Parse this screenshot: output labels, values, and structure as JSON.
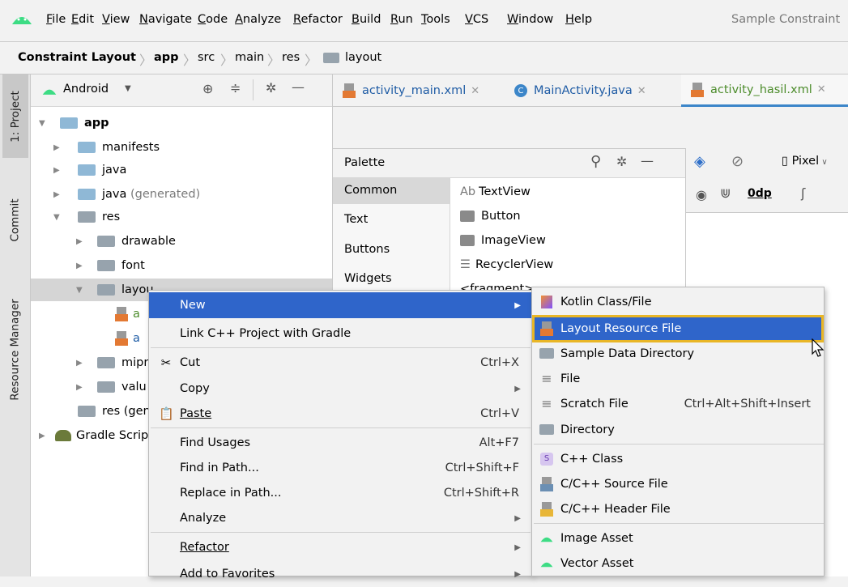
{
  "menubar": {
    "items": [
      "File",
      "Edit",
      "View",
      "Navigate",
      "Code",
      "Analyze",
      "Refactor",
      "Build",
      "Run",
      "Tools",
      "VCS",
      "Window",
      "Help"
    ],
    "window_title": "Sample Constraint"
  },
  "breadcrumb": [
    "Constraint Layout",
    "app",
    "src",
    "main",
    "res",
    "layout"
  ],
  "tool_stripe": {
    "project_tab": "1: Project",
    "commit_tab": "Commit",
    "resource_tab": "Resource Manager"
  },
  "project_panel": {
    "view_selector": "Android",
    "tree": {
      "app": "app",
      "manifests": "manifests",
      "java": "java",
      "java_generated_name": "java",
      "java_generated_suffix": "(generated)",
      "res": "res",
      "drawable": "drawable",
      "font": "font",
      "layout": "layou",
      "file1": "a",
      "file2": "a",
      "mipmap": "mipr",
      "values": "valu",
      "res_generated": "res (gen",
      "gradle_scripts": "Gradle Scrip"
    }
  },
  "tabs": [
    {
      "label": "activity_main.xml"
    },
    {
      "label": "MainActivity.java"
    },
    {
      "label": "activity_hasil.xml"
    }
  ],
  "palette": {
    "title": "Palette",
    "categories": [
      "Common",
      "Text",
      "Buttons",
      "Widgets"
    ],
    "items": [
      "TextView",
      "Button",
      "ImageView",
      "RecyclerView",
      "<fragment>"
    ],
    "textview_prefix": "Ab",
    "device": "Pixel",
    "margin": "0dp"
  },
  "context_menu": {
    "new": "New",
    "link_cpp": "Link C++ Project with Gradle",
    "cut": "Cut",
    "cut_shortcut": "Ctrl+X",
    "copy": "Copy",
    "paste": "Paste",
    "paste_shortcut": "Ctrl+V",
    "find_usages": "Find Usages",
    "find_usages_shortcut": "Alt+F7",
    "find_in_path": "Find in Path...",
    "find_in_path_shortcut": "Ctrl+Shift+F",
    "replace_in_path": "Replace in Path...",
    "replace_in_path_shortcut": "Ctrl+Shift+R",
    "analyze": "Analyze",
    "refactor": "Refactor",
    "add_to_favorites": "Add to Favorites"
  },
  "submenu": {
    "kotlin": "Kotlin Class/File",
    "layout_resource": "Layout Resource File",
    "sample_data": "Sample Data Directory",
    "file": "File",
    "scratch": "Scratch File",
    "scratch_shortcut": "Ctrl+Alt+Shift+Insert",
    "directory": "Directory",
    "cpp_class": "C++ Class",
    "cpp_source": "C/C++ Source File",
    "cpp_header": "C/C++ Header File",
    "image_asset": "Image Asset",
    "vector_asset": "Vector Asset"
  },
  "colors": {
    "selection": "#2f65ca",
    "focus_outline": "#e9b626",
    "android_green": "#3ddc84",
    "folder_blue": "#8fb8d6"
  }
}
